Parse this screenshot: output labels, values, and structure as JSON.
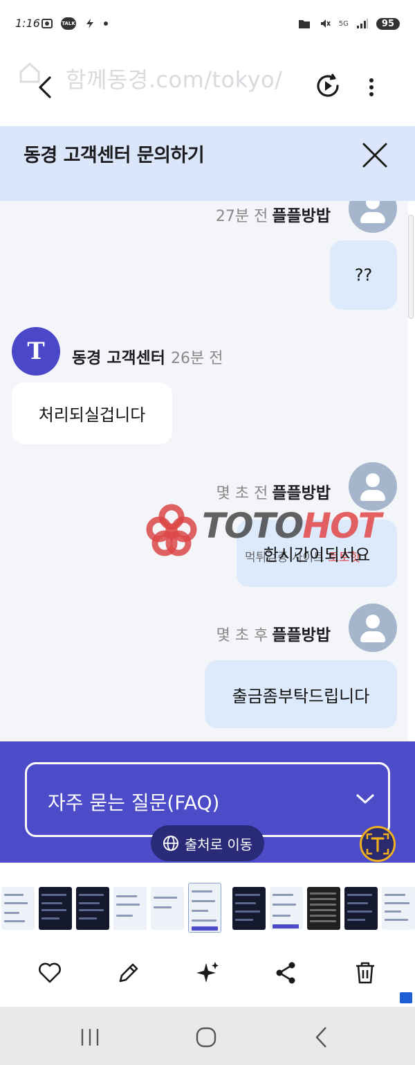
{
  "status_bar": {
    "time": "1:16",
    "battery": "95",
    "network": "5G"
  },
  "browser": {
    "url_ghost": "함께동경.com/tokyo/"
  },
  "panel": {
    "title": "동경 고객센터 문의하기"
  },
  "messages": [
    {
      "side": "out",
      "time": "27분 전",
      "name": "플플방밥",
      "text": "??"
    },
    {
      "side": "in",
      "name": "동경 고객센터",
      "time": "26분 전",
      "avatar_letter": "T",
      "text": "처리되실겁니다"
    },
    {
      "side": "out",
      "time": "몇 초 전",
      "name": "플플방밥",
      "text": "한시간이되서요",
      "hidden_text": "먹튀검증 사이트",
      "hidden_text_red": "토토핫"
    },
    {
      "side": "out",
      "time": "몇 초 후",
      "name": "플플방밥",
      "text": "출금좀부탁드립니다"
    }
  ],
  "watermark": {
    "text_a": "TOTO",
    "text_b": "HOT"
  },
  "faq": {
    "label": "자주 묻는 질문(FAQ)"
  },
  "source_button": {
    "label": "출처로 이동"
  },
  "colors": {
    "accent": "#4c4bc8",
    "header_bg": "#dce6fb",
    "bubble_out": "#dceafc",
    "avatar_letter_bg": "#4a47c9",
    "lens_ring": "#f2b01e"
  },
  "icons": [
    "home-icon",
    "back-icon",
    "play-icon",
    "kebab-icon",
    "close-icon",
    "chevron-down-icon",
    "globe-icon",
    "lens-icon",
    "heart-icon",
    "pencil-icon",
    "sparkle-icon",
    "share-icon",
    "trash-icon",
    "recents-icon",
    "home-nav-icon",
    "back-nav-icon"
  ]
}
